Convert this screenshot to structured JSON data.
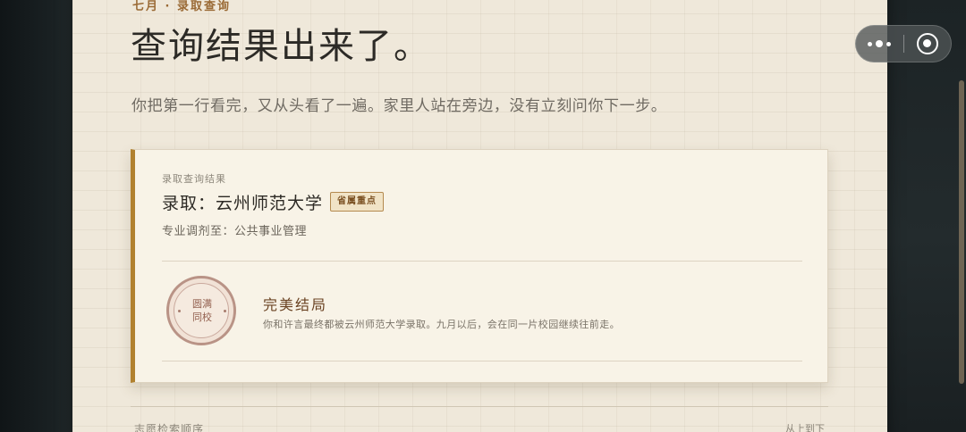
{
  "header": {
    "eyebrow": "七月 · 录取查询",
    "title": "查询结果出来了。",
    "intro": "你把第一行看完，又从头看了一遍。家里人站在旁边，没有立刻问你下一步。"
  },
  "result_card": {
    "caption": "录取查询结果",
    "admission": "录取：云州师范大学",
    "badge": "省属重点",
    "major": "专业调剂至：公共事业管理",
    "seal_text": "圆满\n同校",
    "ending_title": "完美结局",
    "ending_desc": "你和许言最终都被云州师范大学录取。九月以后，会在同一片校园继续往前走。"
  },
  "footer": {
    "section_label": "志愿检索顺序",
    "order_note": "从上到下"
  },
  "capsule": {
    "more": "more-icon",
    "close": "close-icon"
  },
  "colors": {
    "paper": "#efe8da",
    "accent": "#b1812f",
    "seal": "#b99386",
    "title": "#2c2a26"
  }
}
